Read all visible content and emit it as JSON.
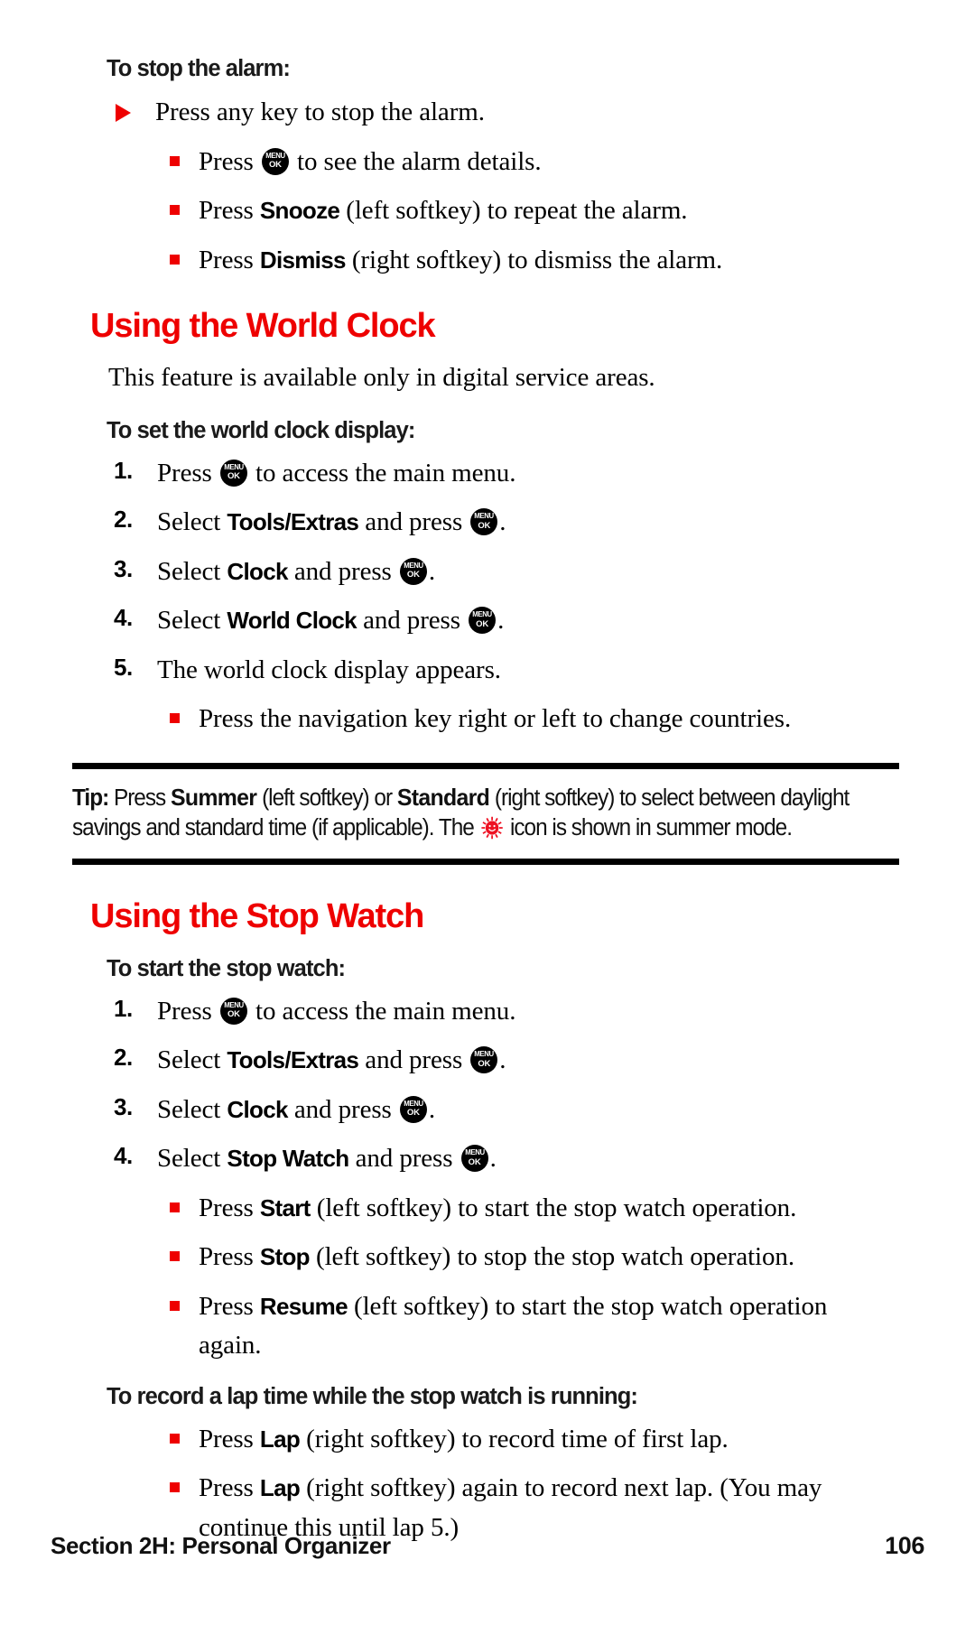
{
  "page": {
    "number": "106",
    "section_label": "Section 2H: Personal Organizer"
  },
  "icons": {
    "menu_key": {
      "top": "MENU",
      "bottom": "OK",
      "name": "menu-ok-key-icon"
    },
    "sun": {
      "name": "summer-sun-icon",
      "color": "#ee1122"
    }
  },
  "sections": [
    {
      "id": "stop-alarm",
      "sub_heading": "To stop the alarm:",
      "items": [
        {
          "bullet": "triangle",
          "parts": [
            {
              "t": "Press any key to stop the alarm."
            }
          ]
        },
        {
          "bullet": "square",
          "parts": [
            {
              "t": "Press "
            },
            {
              "icon": "menu_key"
            },
            {
              "t": " to see the alarm details."
            }
          ]
        },
        {
          "bullet": "square",
          "parts": [
            {
              "t": "Press "
            },
            {
              "b": "Snooze"
            },
            {
              "t": " (left softkey) to repeat the alarm."
            }
          ]
        },
        {
          "bullet": "square",
          "parts": [
            {
              "t": "Press "
            },
            {
              "b": "Dismiss"
            },
            {
              "t": " (right softkey) to dismiss the alarm."
            }
          ]
        }
      ]
    },
    {
      "id": "world-clock",
      "heading": "Using the World Clock",
      "intro": "This feature is available only in digital service areas.",
      "sub_heading": "To set the world clock display:",
      "items": [
        {
          "bullet": "1.",
          "parts": [
            {
              "t": "Press "
            },
            {
              "icon": "menu_key"
            },
            {
              "t": " to access the main menu."
            }
          ]
        },
        {
          "bullet": "2.",
          "parts": [
            {
              "t": "Select "
            },
            {
              "b": "Tools/Extras"
            },
            {
              "t": " and press "
            },
            {
              "icon": "menu_key"
            },
            {
              "t": "."
            }
          ]
        },
        {
          "bullet": "3.",
          "parts": [
            {
              "t": "Select "
            },
            {
              "b": "Clock"
            },
            {
              "t": " and press "
            },
            {
              "icon": "menu_key"
            },
            {
              "t": "."
            }
          ]
        },
        {
          "bullet": "4.",
          "parts": [
            {
              "t": "Select "
            },
            {
              "b": "World Clock"
            },
            {
              "t": " and press "
            },
            {
              "icon": "menu_key"
            },
            {
              "t": "."
            }
          ]
        },
        {
          "bullet": "5.",
          "parts": [
            {
              "t": "The world clock display appears."
            }
          ]
        },
        {
          "bullet": "square",
          "parts": [
            {
              "t": "Press the navigation key right or left to change countries."
            }
          ]
        }
      ]
    }
  ],
  "tip": {
    "label": "Tip:",
    "parts": [
      {
        "t": " Press "
      },
      {
        "b": "Summer"
      },
      {
        "t": " (left softkey) or "
      },
      {
        "b": "Standard"
      },
      {
        "t": " (right softkey) to select between daylight savings and standard time (if applicable). The "
      },
      {
        "icon": "sun"
      },
      {
        "t": " icon is shown in summer mode."
      }
    ]
  },
  "stopwatch": {
    "heading": "Using the Stop Watch",
    "sub_heading_start": "To start the stop watch:",
    "start_items": [
      {
        "bullet": "1.",
        "parts": [
          {
            "t": "Press "
          },
          {
            "icon": "menu_key"
          },
          {
            "t": " to access the main menu."
          }
        ]
      },
      {
        "bullet": "2.",
        "parts": [
          {
            "t": "Select "
          },
          {
            "b": "Tools/Extras"
          },
          {
            "t": " and press "
          },
          {
            "icon": "menu_key"
          },
          {
            "t": "."
          }
        ]
      },
      {
        "bullet": "3.",
        "parts": [
          {
            "t": "Select "
          },
          {
            "b": "Clock"
          },
          {
            "t": " and press "
          },
          {
            "icon": "menu_key"
          },
          {
            "t": "."
          }
        ]
      },
      {
        "bullet": "4.",
        "parts": [
          {
            "t": "Select "
          },
          {
            "b": "Stop Watch"
          },
          {
            "t": " and press "
          },
          {
            "icon": "menu_key"
          },
          {
            "t": "."
          }
        ]
      },
      {
        "bullet": "square",
        "parts": [
          {
            "t": "Press "
          },
          {
            "b": "Start"
          },
          {
            "t": " (left softkey) to start the stop watch operation."
          }
        ]
      },
      {
        "bullet": "square",
        "parts": [
          {
            "t": "Press "
          },
          {
            "b": "Stop"
          },
          {
            "t": " (left softkey) to stop the stop watch operation."
          }
        ]
      },
      {
        "bullet": "square",
        "parts": [
          {
            "t": "Press "
          },
          {
            "b": "Resume"
          },
          {
            "t": " (left softkey) to start the stop watch operation again."
          }
        ]
      }
    ],
    "sub_heading_lap": "To record a lap time while the stop watch is running:",
    "lap_items": [
      {
        "bullet": "square",
        "parts": [
          {
            "t": "Press "
          },
          {
            "b": "Lap"
          },
          {
            "t": " (right softkey) to record time of first lap."
          }
        ]
      },
      {
        "bullet": "square",
        "parts": [
          {
            "t": "Press "
          },
          {
            "b": "Lap"
          },
          {
            "t": " (right softkey) again to record next lap. (You may continue this until lap 5.)"
          }
        ]
      }
    ]
  }
}
